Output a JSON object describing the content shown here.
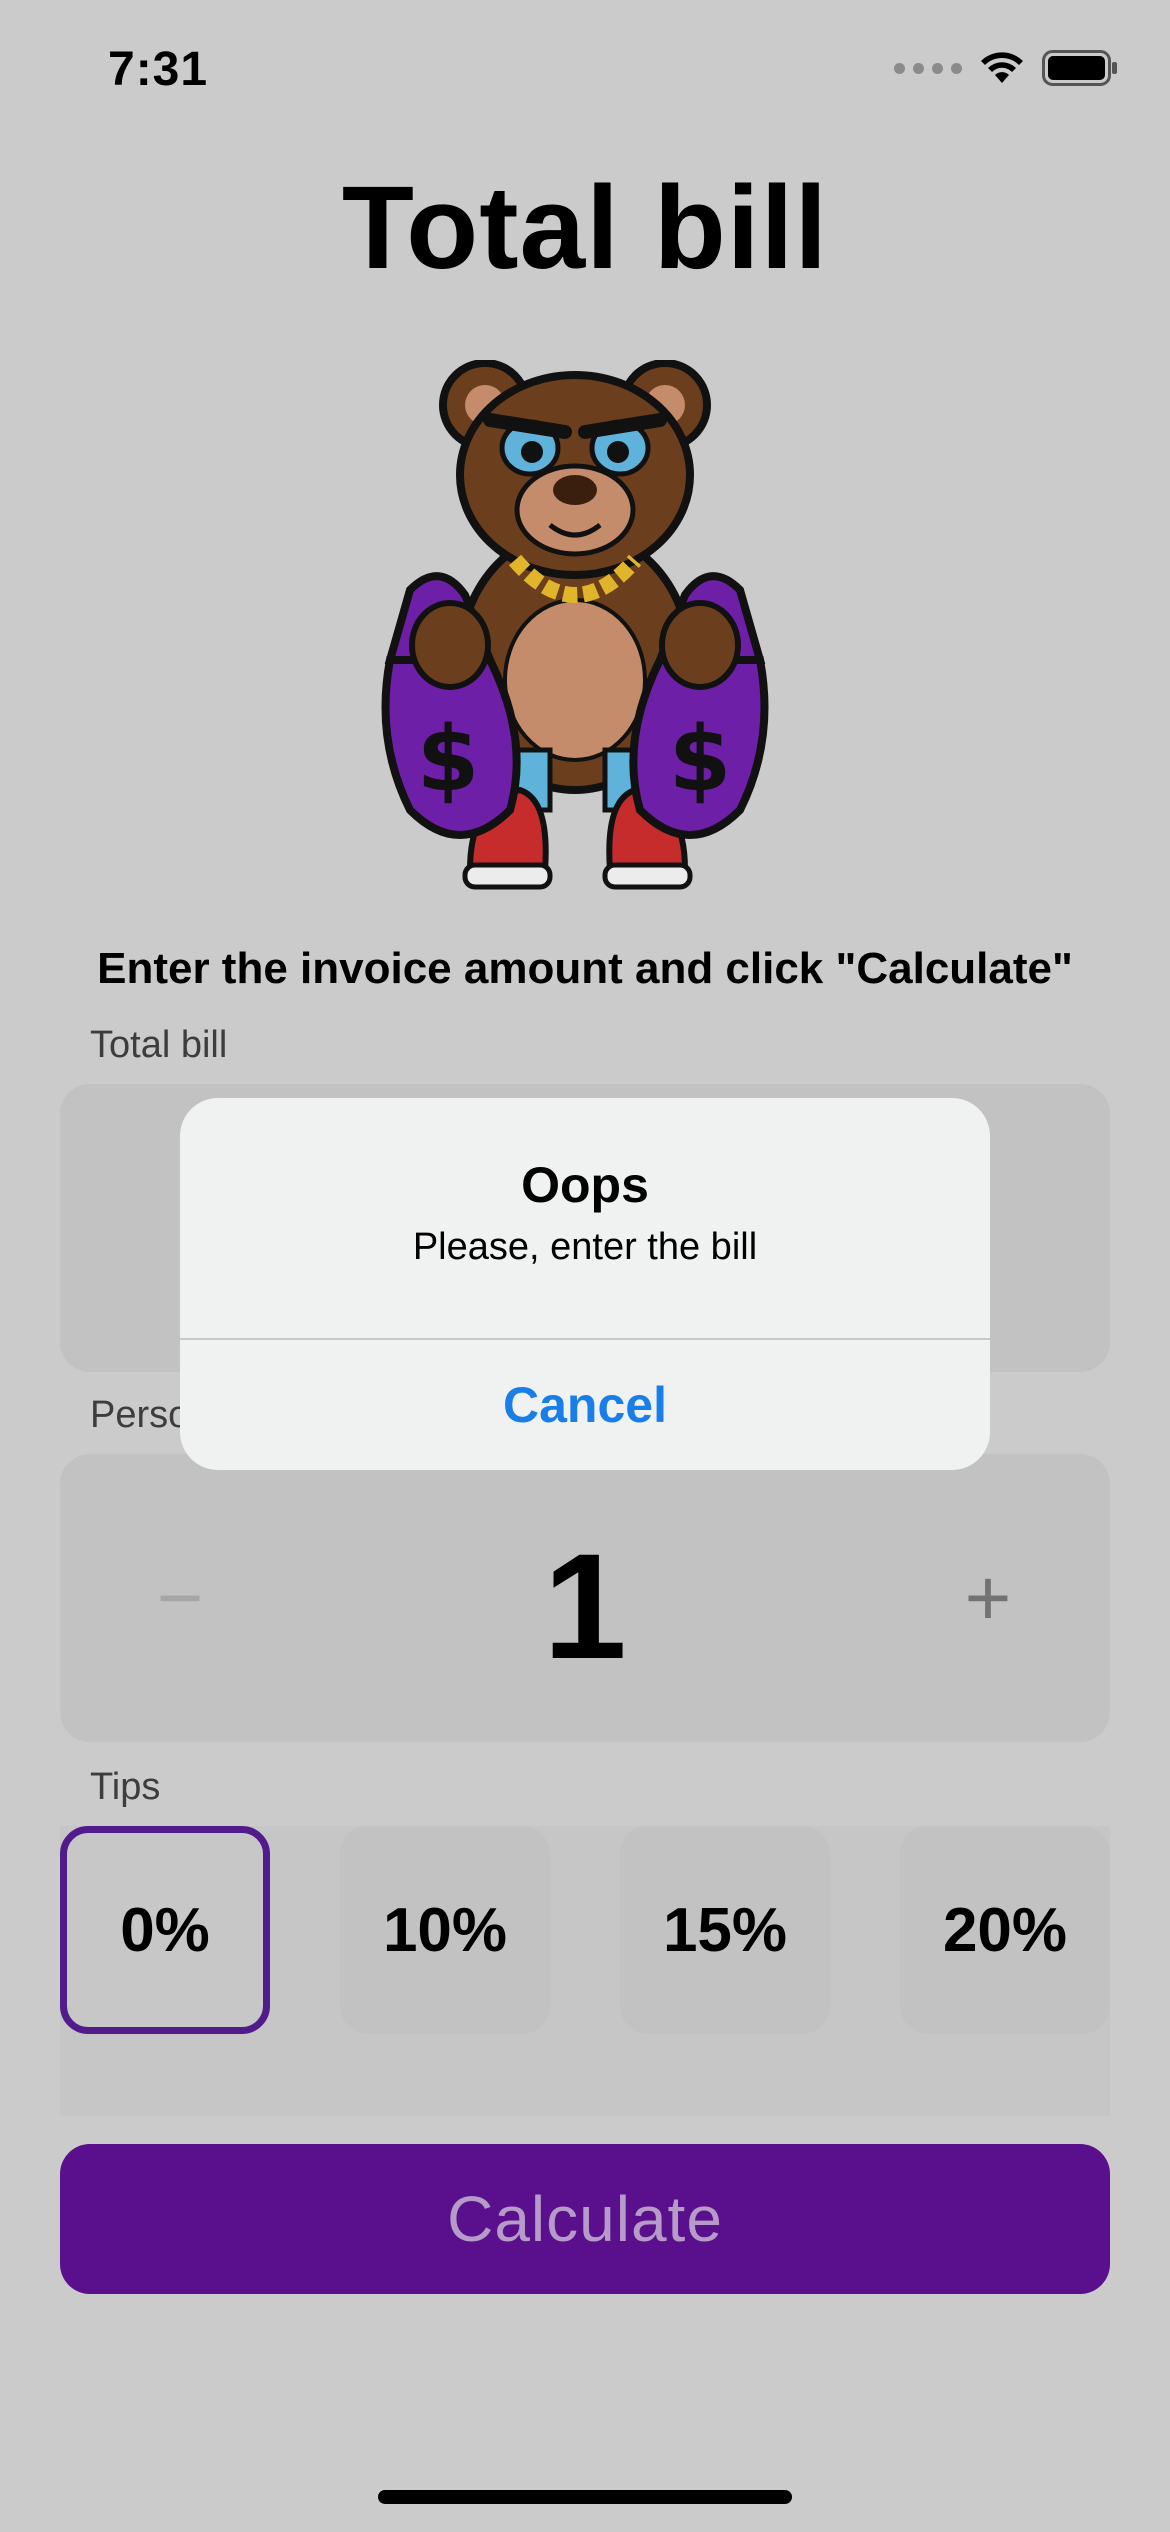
{
  "status_bar": {
    "time": "7:31",
    "icons": [
      "cellular-signal-icon",
      "wifi-icon",
      "battery-icon"
    ]
  },
  "title": "Total bill",
  "illustration": {
    "name": "bear-with-money-bags",
    "bag_symbol": "$"
  },
  "instruction": "Enter the invoice amount and click \"Calculate\"",
  "total_bill": {
    "label": "Total bill",
    "value": ""
  },
  "persons": {
    "label_visible": "Perso",
    "count": "1",
    "minus_icon": "minus-icon",
    "plus_icon": "plus-icon"
  },
  "tips": {
    "label": "Tips",
    "options": [
      "0%",
      "10%",
      "15%",
      "20%"
    ],
    "selected_index": 0
  },
  "calculate_button": "Calculate",
  "alert": {
    "title": "Oops",
    "message": "Please, enter the bill",
    "cancel": "Cancel"
  },
  "colors": {
    "background": "#cbcbcb",
    "accent": "#5a0f8c",
    "alert_background": "#f0f1f1",
    "alert_button": "#1a7ee8"
  }
}
